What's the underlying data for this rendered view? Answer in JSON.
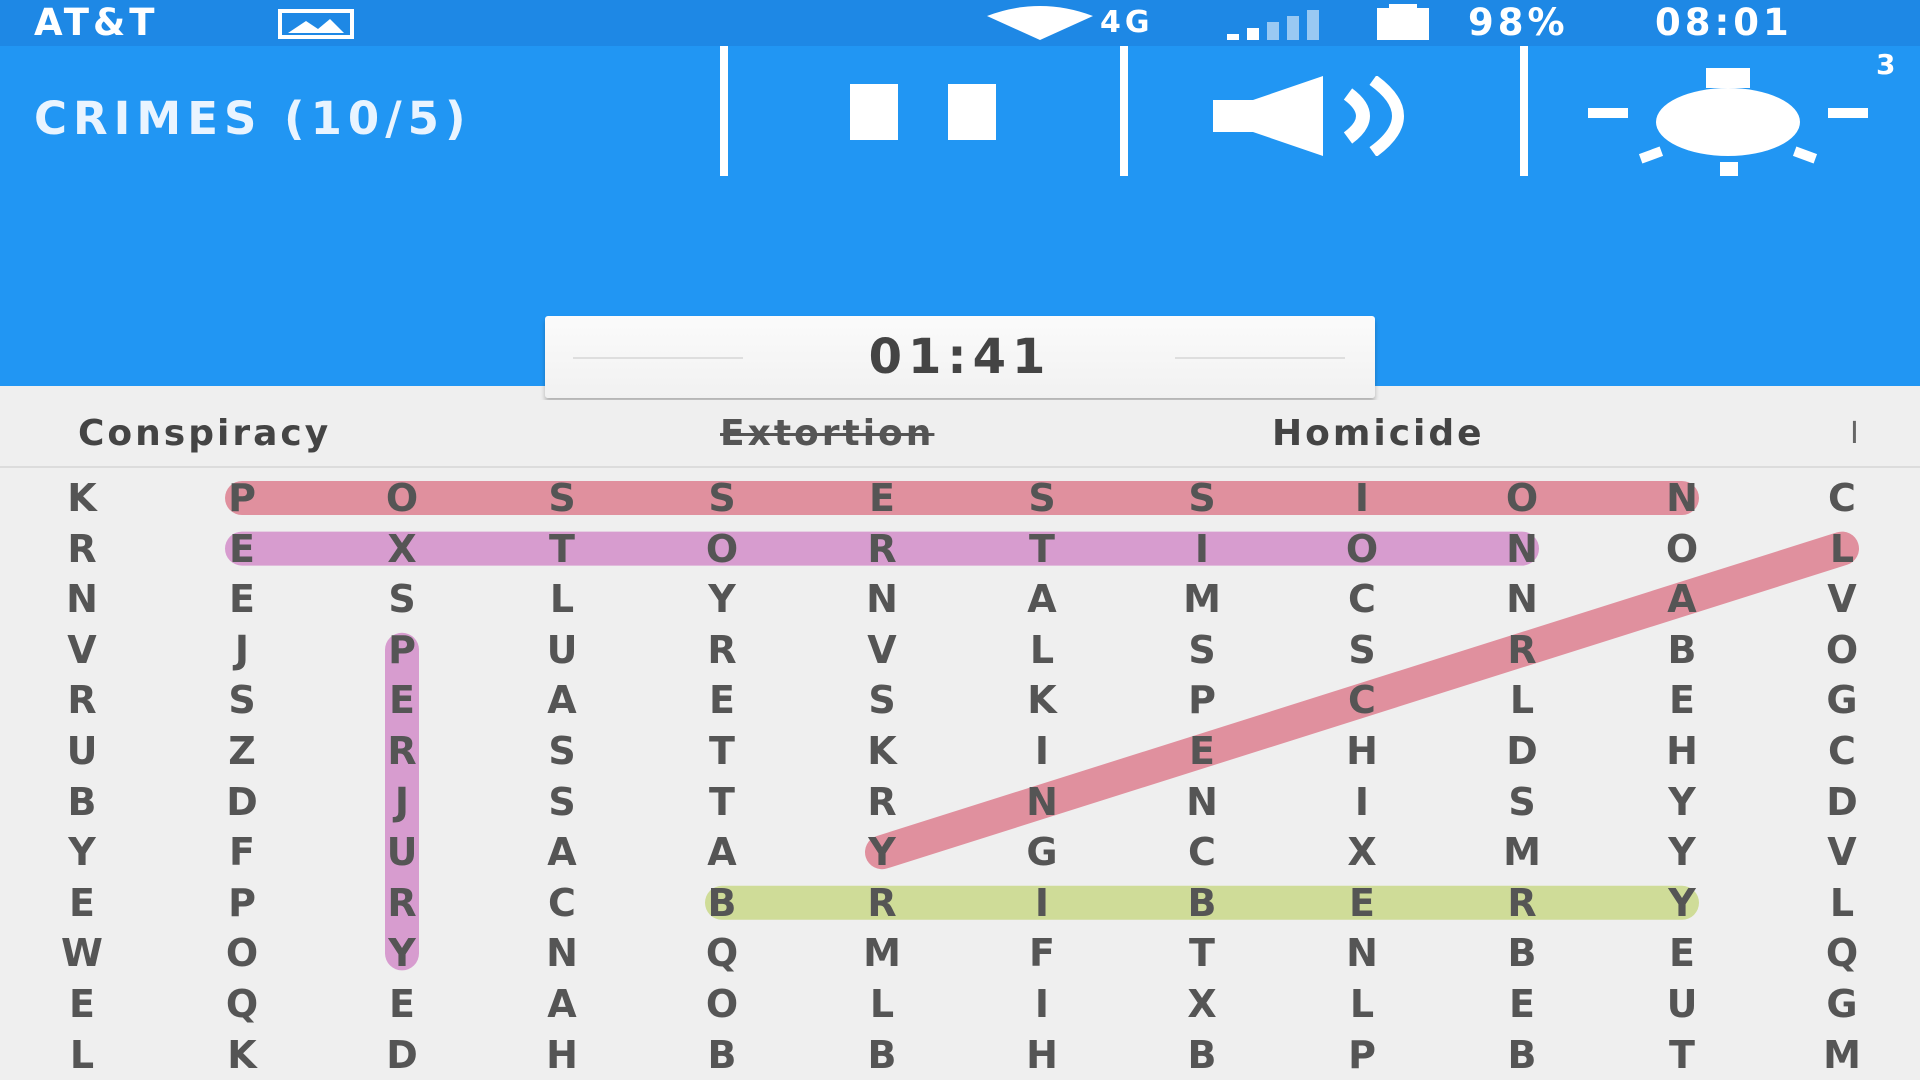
{
  "status_bar": {
    "carrier": "AT&T",
    "network": "4G",
    "battery": "98%",
    "time": "08:01"
  },
  "toolbar": {
    "title": "CRIMES (10/5)",
    "pause_icon": "pause-icon",
    "sound_icon": "speaker-icon",
    "hint_icon": "lightbulb-icon",
    "hint_count": "3"
  },
  "timer": {
    "value": "01:41"
  },
  "word_list": {
    "words": [
      {
        "text": "Conspiracy",
        "found": false
      },
      {
        "text": "Extortion",
        "found": true
      },
      {
        "text": "Homicide",
        "found": false
      }
    ],
    "more_indicator": "I"
  },
  "grid": {
    "rows": [
      [
        "K",
        "P",
        "O",
        "S",
        "S",
        "E",
        "S",
        "S",
        "I",
        "O",
        "N",
        "C"
      ],
      [
        "R",
        "E",
        "X",
        "T",
        "O",
        "R",
        "T",
        "I",
        "O",
        "N",
        "O",
        "L"
      ],
      [
        "N",
        "E",
        "S",
        "L",
        "Y",
        "N",
        "A",
        "M",
        "C",
        "N",
        "A",
        "V"
      ],
      [
        "V",
        "J",
        "P",
        "U",
        "R",
        "V",
        "L",
        "S",
        "S",
        "R",
        "B",
        "O"
      ],
      [
        "R",
        "S",
        "E",
        "A",
        "E",
        "S",
        "K",
        "P",
        "C",
        "L",
        "E",
        "G"
      ],
      [
        "U",
        "Z",
        "R",
        "S",
        "T",
        "K",
        "I",
        "E",
        "H",
        "D",
        "H",
        "C"
      ],
      [
        "B",
        "D",
        "J",
        "S",
        "T",
        "R",
        "N",
        "N",
        "I",
        "S",
        "Y",
        "D"
      ],
      [
        "Y",
        "F",
        "U",
        "A",
        "A",
        "Y",
        "G",
        "C",
        "X",
        "M",
        "Y",
        "V"
      ],
      [
        "E",
        "P",
        "R",
        "C",
        "B",
        "R",
        "I",
        "B",
        "E",
        "R",
        "Y",
        "L"
      ],
      [
        "W",
        "O",
        "Y",
        "N",
        "Q",
        "M",
        "F",
        "T",
        "N",
        "B",
        "E",
        "Q"
      ],
      [
        "E",
        "Q",
        "E",
        "A",
        "O",
        "L",
        "I",
        "X",
        "L",
        "E",
        "U",
        "G"
      ],
      [
        "L",
        "K",
        "D",
        "H",
        "B",
        "B",
        "H",
        "B",
        "P",
        "B",
        "T",
        "M"
      ]
    ],
    "found_words": [
      {
        "word": "POSSESSION",
        "start": [
          0,
          1
        ],
        "end": [
          0,
          10
        ],
        "color": "#e0909e"
      },
      {
        "word": "EXTORTION",
        "start": [
          1,
          1
        ],
        "end": [
          1,
          9
        ],
        "color": "#d79ccf"
      },
      {
        "word": "PERJURY",
        "start": [
          3,
          2
        ],
        "end": [
          9,
          2
        ],
        "color": "#d79ccf"
      },
      {
        "word": "BRIBERY",
        "start": [
          8,
          4
        ],
        "end": [
          8,
          10
        ],
        "color": "#cfdc98"
      },
      {
        "word": "LARCENY",
        "start": [
          1,
          11
        ],
        "end": [
          7,
          5
        ],
        "color": "#e0909e"
      }
    ]
  },
  "colors": {
    "status_bar": "#1e88e5",
    "toolbar": "#2196f3",
    "background": "#efefef",
    "letter": "#555555"
  }
}
